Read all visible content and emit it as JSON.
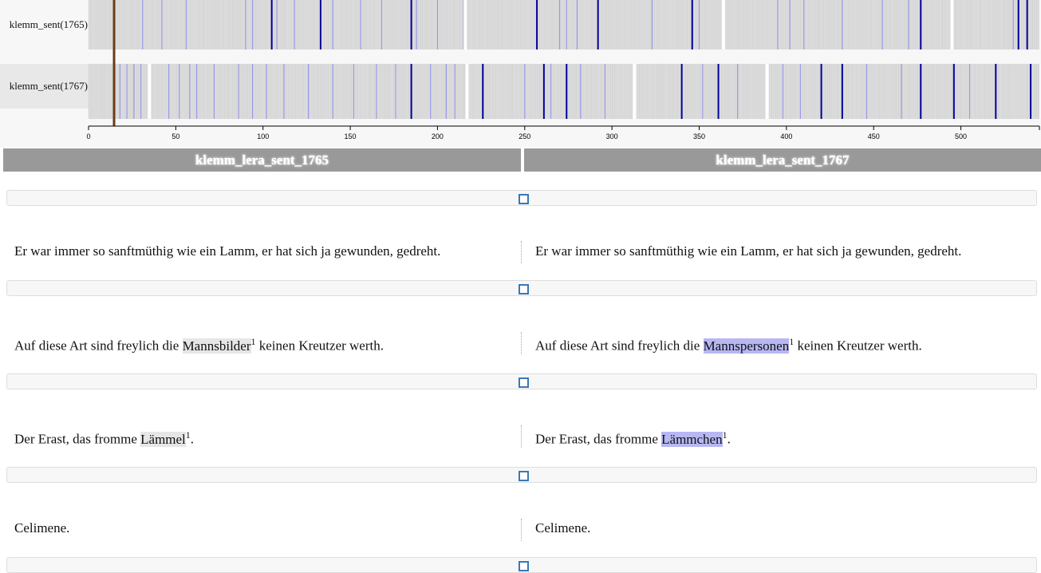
{
  "visualization": {
    "rows": [
      {
        "label": "klemm_sent(1765)"
      },
      {
        "label": "klemm_sent(1767)"
      }
    ],
    "axis_ticks": [
      "0",
      "50",
      "100",
      "150",
      "200",
      "250",
      "300",
      "350",
      "400",
      "450",
      "500"
    ],
    "colors": {
      "background": "#dcdcdc",
      "light_variant": "#9a9ae8",
      "dark_variant": "#000099",
      "cursor": "#6b3b1a"
    }
  },
  "columns": {
    "left_title": "klemm_lera_sent_1765",
    "right_title": "klemm_lera_sent_1767"
  },
  "pairs": [
    {
      "left": {
        "pre": "Er war immer so sanftmüthig wie ein Lamm, er hat sich ja gewunden, gedreht.",
        "hl": "",
        "sup": "",
        "post": ""
      },
      "right": {
        "pre": "Er war immer so sanftmüthig wie ein Lamm, er hat sich ja gewunden, gedreht.",
        "hl": "",
        "sup": "",
        "post": ""
      }
    },
    {
      "left": {
        "pre": "Auf diese Art sind freylich die ",
        "hl": "Mannsbilder",
        "sup": "1",
        "post": " keinen Kreutzer werth."
      },
      "right": {
        "pre": "Auf diese Art sind freylich die ",
        "hl": "Mannspersonen",
        "sup": "1",
        "post": " keinen Kreutzer werth."
      }
    },
    {
      "left": {
        "pre": "Der Erast, das fromme ",
        "hl": "Lämmel",
        "sup": "1",
        "post": "."
      },
      "right": {
        "pre": "Der Erast, das fromme ",
        "hl": "Lämmchen",
        "sup": "1",
        "post": "."
      }
    },
    {
      "left": {
        "pre": "Celimene.",
        "hl": "",
        "sup": "",
        "post": ""
      },
      "right": {
        "pre": "Celimene.",
        "hl": "",
        "sup": "",
        "post": ""
      }
    }
  ]
}
